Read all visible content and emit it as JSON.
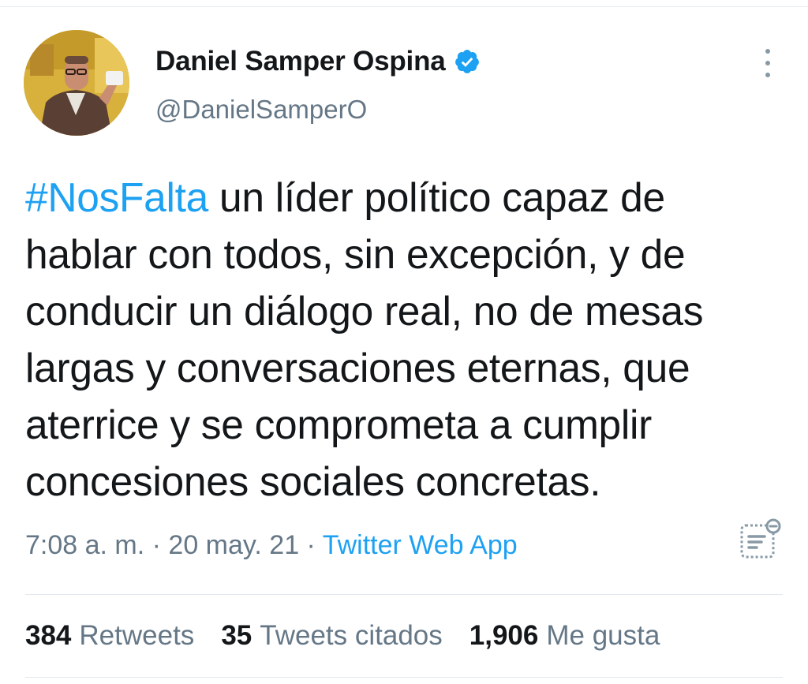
{
  "tweet": {
    "author": {
      "display_name": "Daniel Samper Ospina",
      "handle": "@DanielSamperO",
      "verified": true
    },
    "text": {
      "hashtag": "#NosFalta",
      "line1_rest": " un líder político capaz de",
      "line2": "hablar con todos, sin excepción, y de",
      "line3": "conducir un diálogo real, no de mesas",
      "line4": "largas y conversaciones eternas, que",
      "line5": "aterrice y se comprometa a cumplir",
      "line6": "concesiones sociales concretas."
    },
    "meta": {
      "time": "7:08 a. m.",
      "separator1": " · ",
      "date": "20 may. 21",
      "separator2": " · ",
      "source": "Twitter Web App"
    },
    "stats": {
      "retweets_count": "384",
      "retweets_label": "Retweets",
      "quotes_count": "35",
      "quotes_label": "Tweets citados",
      "likes_count": "1,906",
      "likes_label": "Me gusta"
    }
  },
  "icons": {
    "verified": "verified-badge-icon",
    "more": "more-vertical-icon",
    "analytics": "tweet-analytics-icon"
  },
  "colors": {
    "accent": "#1da1f2",
    "text_primary": "#14171a",
    "text_secondary": "#657786",
    "divider": "#e1e8ed"
  }
}
